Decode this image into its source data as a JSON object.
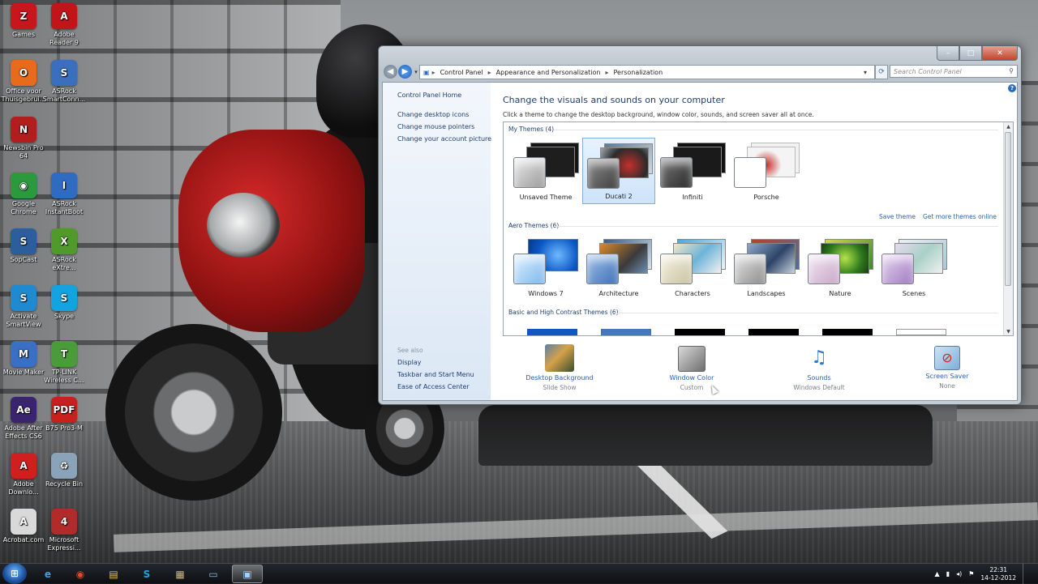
{
  "desktop": {
    "icons": [
      {
        "label": "Games",
        "label2": "",
        "icon": "zynga-games-icon",
        "color": "#c8161d",
        "glyph": "Z"
      },
      {
        "label": "Adobe",
        "label2": "Reader 9",
        "icon": "adobe-reader-icon",
        "color": "#c0161a",
        "glyph": "A"
      },
      {
        "label": "Office voor",
        "label2": "Thuisgebrui...",
        "icon": "office-icon",
        "color": "#e86a1c",
        "glyph": "O"
      },
      {
        "label": "ASRock",
        "label2": "SmartConn...",
        "icon": "asrock-smartconnect-icon",
        "color": "#3a6fbd",
        "glyph": "S"
      },
      {
        "label": "Newsbin Pro",
        "label2": "64",
        "icon": "newsbin-icon",
        "color": "#b21e1e",
        "glyph": "N"
      },
      {
        "label": "Google",
        "label2": "Chrome",
        "icon": "chrome-icon",
        "color": "#2b9a3e",
        "glyph": "◉"
      },
      {
        "label": "ASRock",
        "label2": "InstantBoot",
        "icon": "asrock-instantboot-icon",
        "color": "#2f6bc3",
        "glyph": "I"
      },
      {
        "label": "SopCast",
        "label2": "",
        "icon": "sopcast-icon",
        "color": "#2c5e9e",
        "glyph": "S"
      },
      {
        "label": "ASRock",
        "label2": "eXtre...",
        "icon": "asrock-xfast-icon",
        "color": "#4f9a2a",
        "glyph": "X"
      },
      {
        "label": "Activate",
        "label2": "SmartView",
        "icon": "smartview-icon",
        "color": "#1f8ad0",
        "glyph": "S"
      },
      {
        "label": "Skype",
        "label2": "",
        "icon": "skype-icon",
        "color": "#13a3e0",
        "glyph": "S"
      },
      {
        "label": "Movie Maker",
        "label2": "",
        "icon": "movie-maker-icon",
        "color": "#3b6fc6",
        "glyph": "M"
      },
      {
        "label": "TP-LINK",
        "label2": "Wireless C...",
        "icon": "tplink-icon",
        "color": "#4a9c3a",
        "glyph": "T"
      },
      {
        "label": "Adobe After",
        "label2": "Effects CS6",
        "icon": "after-effects-icon",
        "color": "#3a2470",
        "glyph": "Ae"
      },
      {
        "label": "B75 Pro3-M",
        "label2": "",
        "icon": "pdf-file-icon",
        "color": "#c8201c",
        "glyph": "PDF"
      },
      {
        "label": "Adobe",
        "label2": "Downlo...",
        "icon": "adobe-download-icon",
        "color": "#d01f1f",
        "glyph": "A"
      },
      {
        "label": "Recycle Bin",
        "label2": "",
        "icon": "recycle-bin-icon",
        "color": "#8aa3b8",
        "glyph": "♻"
      },
      {
        "label": "Acrobat.com",
        "label2": "",
        "icon": "acrobat-com-icon",
        "color": "#d9d9d9",
        "glyph": "A"
      },
      {
        "label": "Microsoft",
        "label2": "Expressi...",
        "icon": "expression-icon",
        "color": "#b22b2b",
        "glyph": "4"
      }
    ]
  },
  "window": {
    "breadcrumb": [
      "Control Panel",
      "Appearance and Personalization",
      "Personalization"
    ],
    "search_placeholder": "Search Control Panel",
    "left_nav": {
      "home": "Control Panel Home",
      "links": [
        "Change desktop icons",
        "Change mouse pointers",
        "Change your account picture"
      ],
      "see_also_label": "See also",
      "see_also": [
        "Display",
        "Taskbar and Start Menu",
        "Ease of Access Center"
      ]
    },
    "heading": "Change the visuals and sounds on your computer",
    "description": "Click a theme to change the desktop background, window color, sounds, and screen saver all at once.",
    "my_themes": {
      "label": "My Themes (4)",
      "items": [
        "Unsaved Theme",
        "Ducati 2",
        "Infiniti",
        "Porsche"
      ],
      "selected": "Ducati 2",
      "save_link": "Save theme",
      "more_link": "Get more themes online"
    },
    "aero_themes": {
      "label": "Aero Themes (6)",
      "items": [
        "Windows 7",
        "Architecture",
        "Characters",
        "Landscapes",
        "Nature",
        "Scenes"
      ]
    },
    "basic_themes": {
      "label": "Basic and High Contrast Themes (6)"
    },
    "bottom": [
      {
        "label": "Desktop Background",
        "sub": "Slide Show",
        "icon": "desktop-background-icon"
      },
      {
        "label": "Window Color",
        "sub": "Custom",
        "icon": "window-color-icon"
      },
      {
        "label": "Sounds",
        "sub": "Windows Default",
        "icon": "sounds-icon"
      },
      {
        "label": "Screen Saver",
        "sub": "None",
        "icon": "screen-saver-icon"
      }
    ]
  },
  "taskbar": {
    "time": "22:31",
    "date": "14-12-2012"
  }
}
